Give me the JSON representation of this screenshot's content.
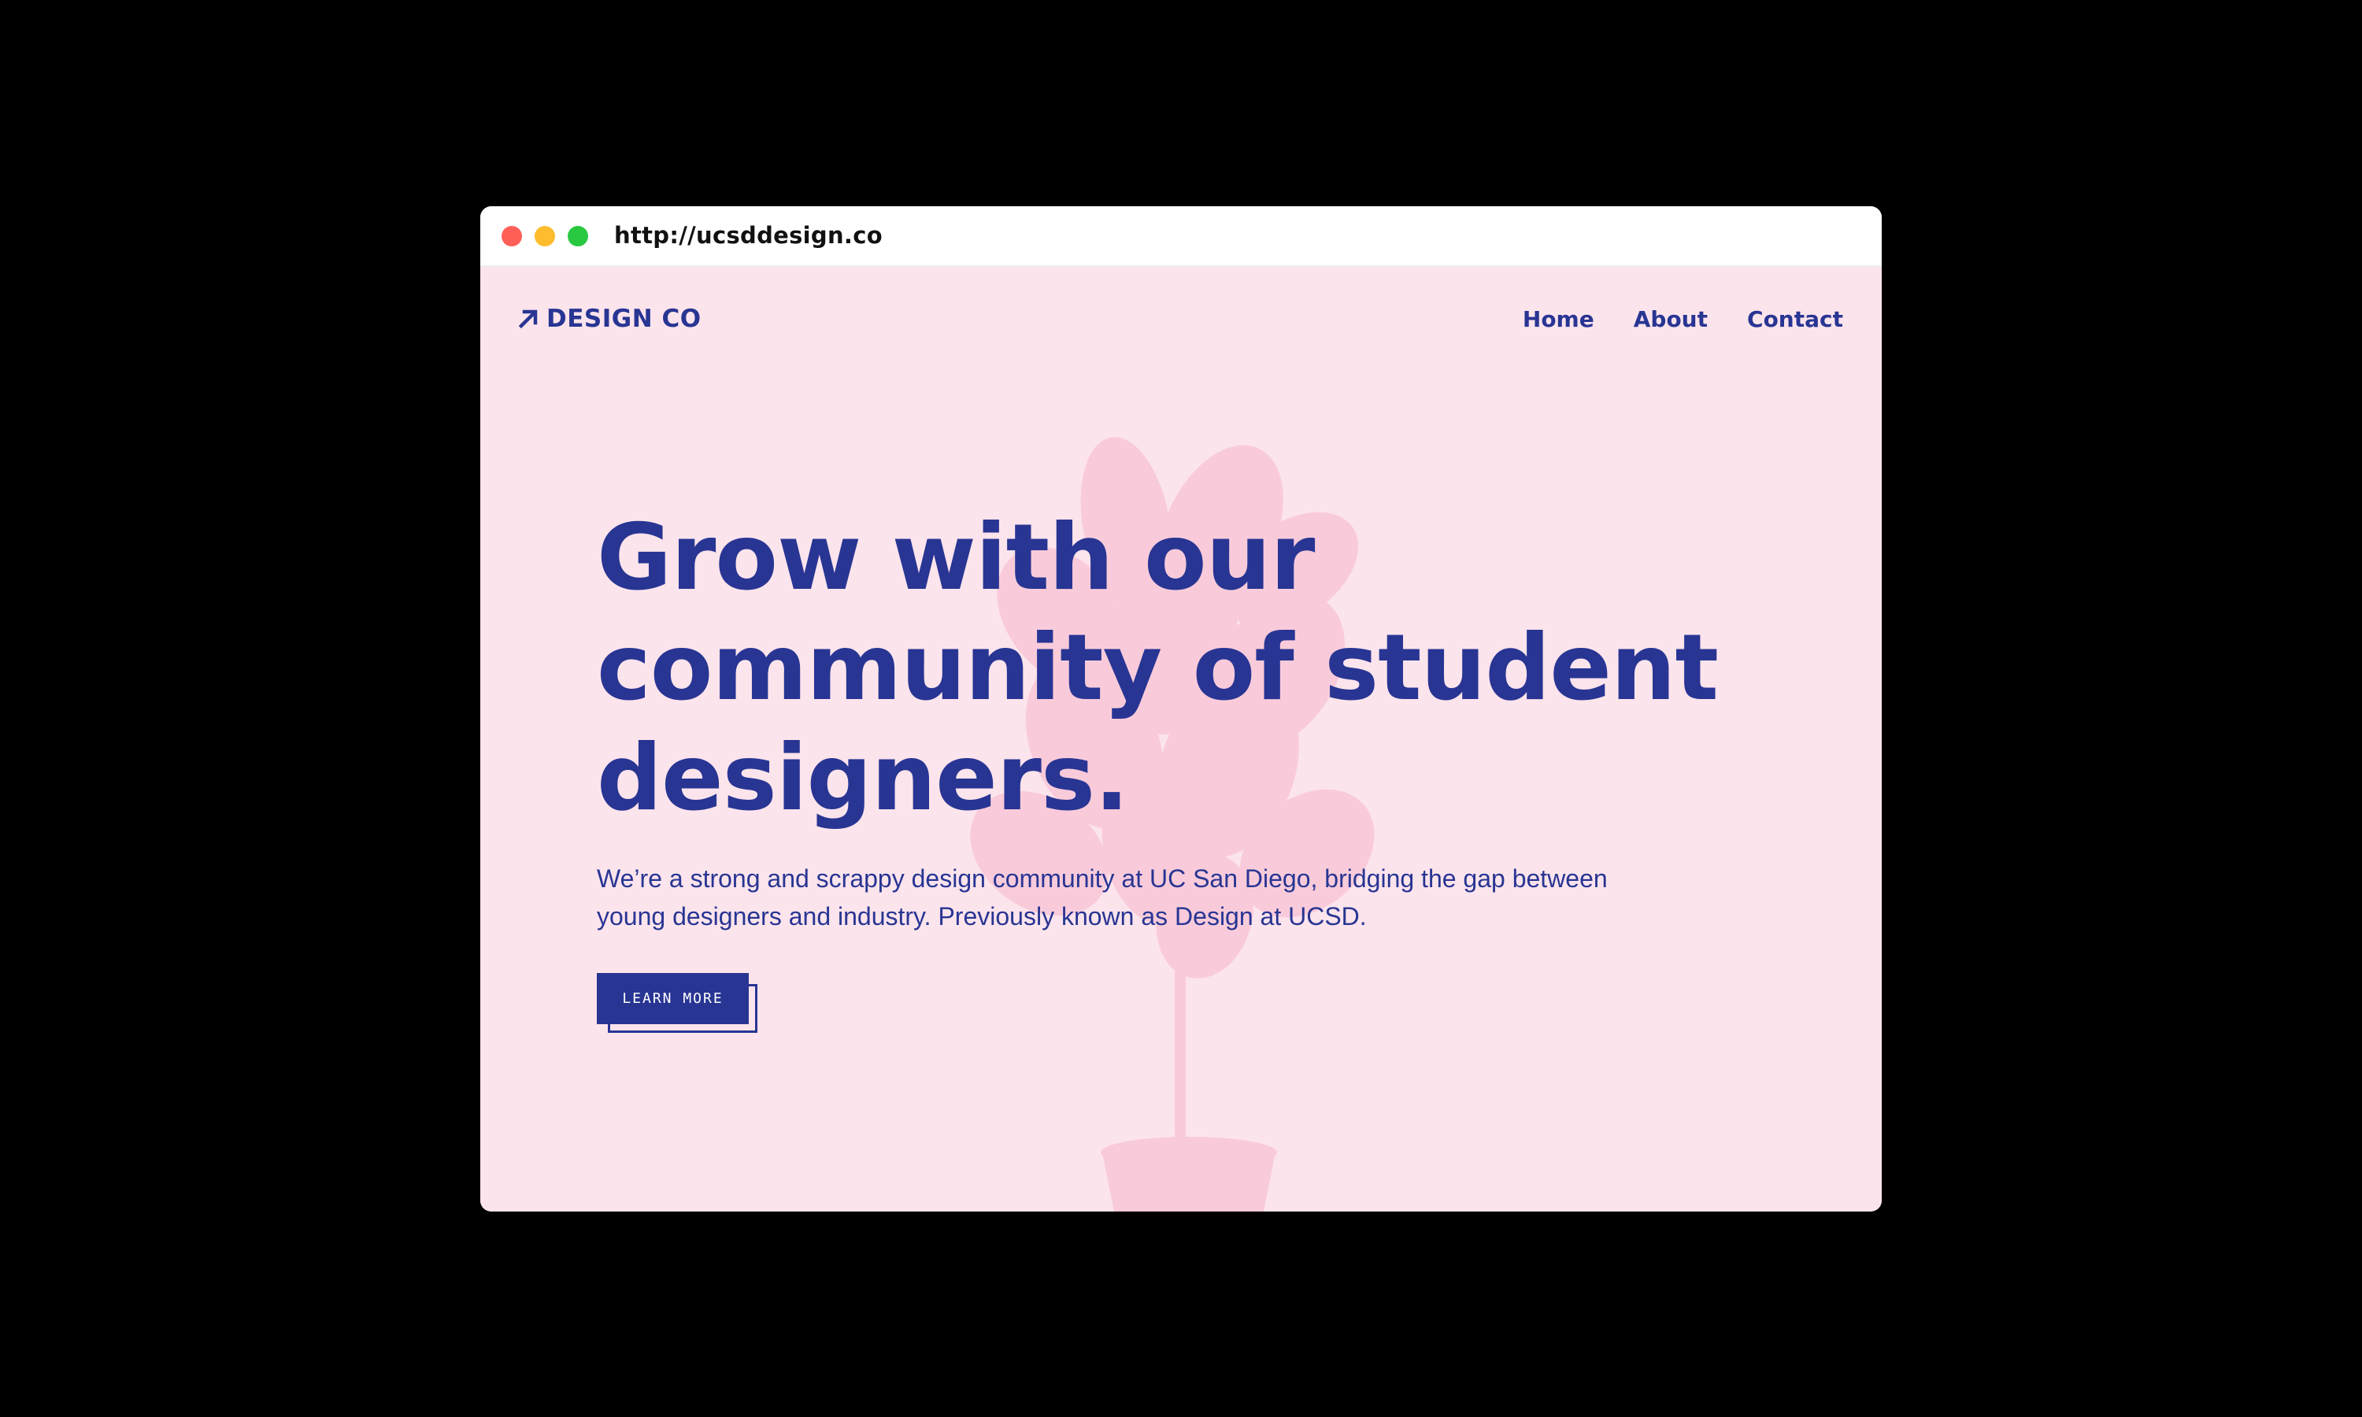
{
  "browser": {
    "url": "http://ucsddesign.co",
    "traffic_lights": {
      "close_color": "#ff5f57",
      "minimize_color": "#febc2e",
      "zoom_color": "#28c840"
    }
  },
  "header": {
    "logo_icon": "arrow-up-right-icon",
    "logo_text": "DESIGN CO",
    "nav": [
      "Home",
      "About",
      "Contact"
    ]
  },
  "hero": {
    "headline": "Grow with our community of student designers.",
    "description": "We’re a strong and scrappy design community at UC San Diego, bridging the gap between young designers and industry. Previously known as Design at UCSD.",
    "cta_label": "LEARN MORE",
    "background_icon": "fiddle-leaf-fig-plant-icon"
  },
  "colors": {
    "brand": "#283593",
    "page_background": "#fce4ec",
    "plant_tint": "#f8c3d4"
  }
}
